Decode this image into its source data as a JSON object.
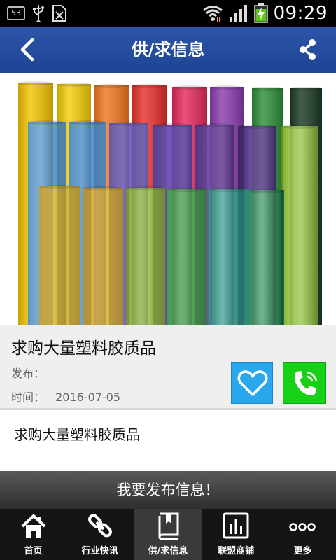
{
  "status_bar": {
    "badge": "53",
    "time": "09:29",
    "icons": [
      "notification-badge-icon",
      "usb-icon",
      "sim-card-icon",
      "wifi-icon",
      "signal-icon",
      "battery-charging-icon"
    ]
  },
  "header": {
    "title": "供/求信息",
    "back_icon": "back-arrow-icon",
    "share_icon": "share-icon"
  },
  "product": {
    "image_alt": "plastic-rolls-photo",
    "title": "求购大量塑料胶质品",
    "publisher_label": "发布：",
    "time_label": "时间：",
    "time_value": "2016-07-05",
    "description": "求购大量塑料胶质品"
  },
  "actions": {
    "favorite_icon": "heart-icon",
    "call_icon": "phone-icon",
    "favorite_color": "#29a8ee",
    "call_color": "#16d116"
  },
  "publish_bar": {
    "label": "我要发布信息！"
  },
  "bottom_nav": {
    "items": [
      {
        "label": "首页",
        "icon": "home-icon"
      },
      {
        "label": "行业快讯",
        "icon": "link-icon"
      },
      {
        "label": "供/求信息",
        "icon": "book-icon"
      },
      {
        "label": "联盟商铺",
        "icon": "bar-chart-icon"
      },
      {
        "label": "更多",
        "icon": "more-dots-icon"
      }
    ],
    "active_index": 2
  },
  "colors": {
    "header_blue": "#2d56a8",
    "info_bg": "#efefef",
    "nav_bg": "#151515"
  }
}
